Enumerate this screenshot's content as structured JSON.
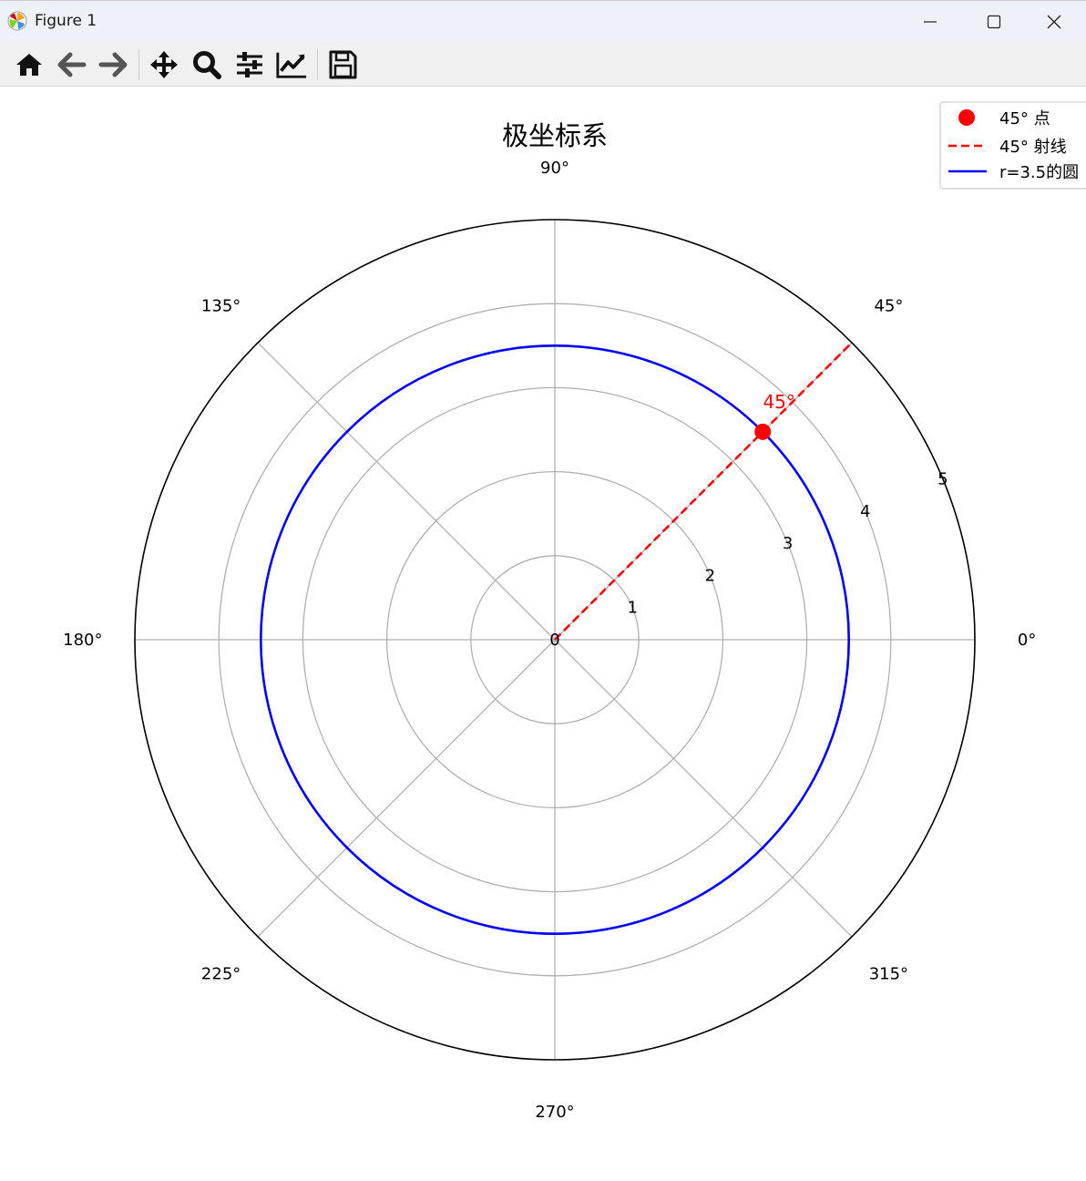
{
  "window": {
    "title": "Figure 1",
    "controls": [
      "minimize",
      "maximize",
      "close"
    ]
  },
  "toolbar": {
    "buttons": [
      {
        "name": "home-button",
        "icon": "home-icon"
      },
      {
        "name": "back-button",
        "icon": "arrow-left-icon"
      },
      {
        "name": "forward-button",
        "icon": "arrow-right-icon"
      },
      {
        "name": "pan-button",
        "icon": "move-icon"
      },
      {
        "name": "zoom-button",
        "icon": "magnifier-icon"
      },
      {
        "name": "configure-subplots-button",
        "icon": "sliders-icon"
      },
      {
        "name": "edit-axis-button",
        "icon": "line-chart-icon"
      },
      {
        "name": "save-button",
        "icon": "floppy-disk-icon"
      }
    ]
  },
  "chart_data": {
    "type": "polar",
    "title": "极坐标系",
    "r_ticks": [
      "0",
      "1",
      "2",
      "3",
      "4",
      "5"
    ],
    "r_tick_values": [
      0,
      1,
      2,
      3,
      4,
      5
    ],
    "rlim": [
      0,
      5
    ],
    "r_label_angle_deg": 22.5,
    "theta_ticks": [
      "0°",
      "45°",
      "90°",
      "135°",
      "180°",
      "225°",
      "270°",
      "315°"
    ],
    "theta_tick_values_deg": [
      0,
      45,
      90,
      135,
      180,
      225,
      270,
      315
    ],
    "grid": true,
    "series": [
      {
        "name": "45° 点",
        "kind": "point",
        "theta_deg": 45,
        "r": 3.5,
        "color": "#ff0000",
        "annotation": "45°"
      },
      {
        "name": "45° 射线",
        "kind": "ray",
        "theta_deg": 45,
        "r": [
          0,
          5
        ],
        "color": "#ff0000",
        "linestyle": "dashed"
      },
      {
        "name": "r=3.5的圆",
        "kind": "circle",
        "r": 3.5,
        "color": "#0000ff",
        "linestyle": "solid"
      }
    ],
    "legend": {
      "placement": "top-right",
      "entries": [
        "45° 点",
        "45° 射线",
        "r=3.5的圆"
      ]
    }
  }
}
